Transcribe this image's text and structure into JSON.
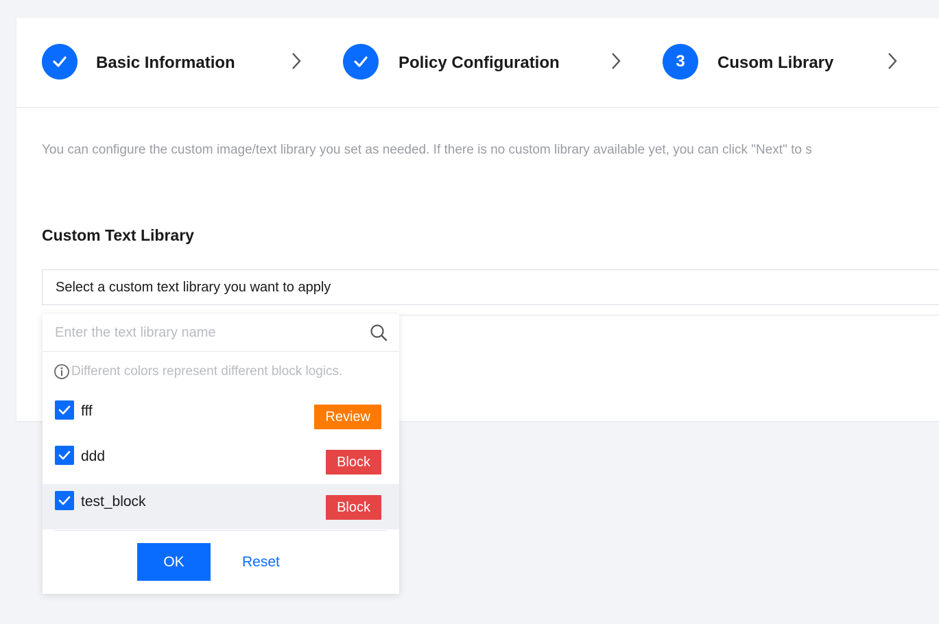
{
  "steps": [
    {
      "label": "Basic Information",
      "state": "done"
    },
    {
      "label": "Policy Configuration",
      "state": "done"
    },
    {
      "label": "Cusom Library",
      "state": "current",
      "number": "3"
    }
  ],
  "intro_text": "You can configure the custom image/text library you set as needed. If there is no custom library available yet, you can click \"Next\" to s",
  "section_title": "Custom Text Library",
  "select_placeholder": "Select a custom text library you want to apply",
  "dropdown": {
    "search_placeholder": "Enter the text library name",
    "hint": "Different colors represent different block logics.",
    "items": [
      {
        "label": "fff",
        "checked": true,
        "tag": "Review",
        "tag_color": "#ff7a00"
      },
      {
        "label": "ddd",
        "checked": true,
        "tag": "Block",
        "tag_color": "#e54545"
      },
      {
        "label": "test_block",
        "checked": true,
        "tag": "Block",
        "tag_color": "#e54545"
      }
    ],
    "ok_label": "OK",
    "reset_label": "Reset"
  },
  "colors": {
    "primary": "#0a6cff",
    "review": "#ff7a00",
    "block": "#e54545"
  }
}
